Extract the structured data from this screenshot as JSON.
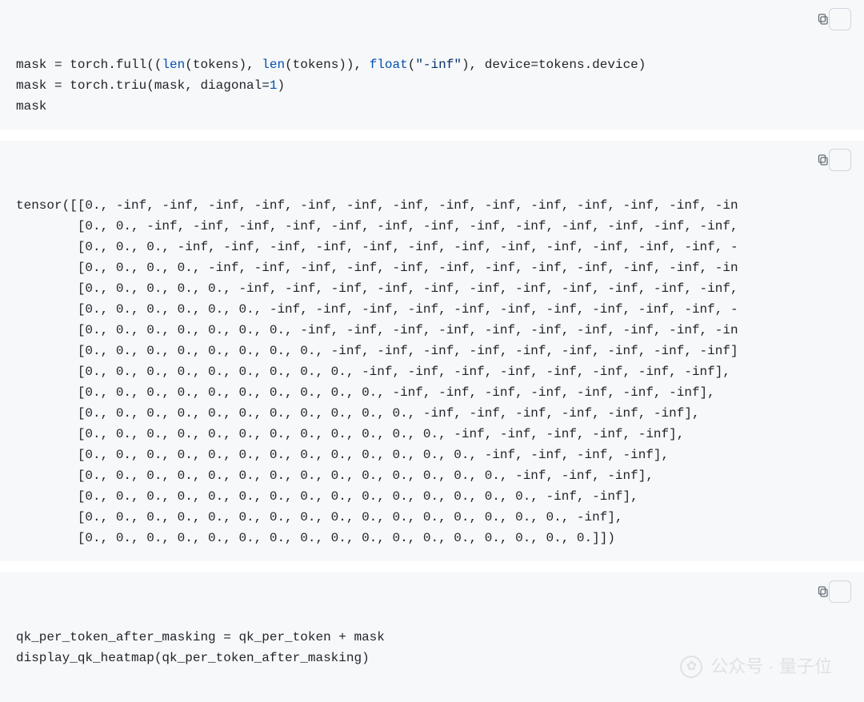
{
  "code1": {
    "line1": {
      "pre": "mask = torch.full((",
      "len1": "len",
      "mid1": "(tokens), ",
      "len2": "len",
      "mid2": "(tokens)), ",
      "float": "float",
      "mid3": "(",
      "str": "\"-inf\"",
      "mid4": "), device=tokens.device)"
    },
    "line2": {
      "pre": "mask = torch.triu(mask, diagonal=",
      "num": "1",
      "post": ")"
    },
    "line3": "mask"
  },
  "tensor_lines": [
    "tensor([[0., -inf, -inf, -inf, -inf, -inf, -inf, -inf, -inf, -inf, -inf, -inf, -inf, -inf, -in",
    "        [0., 0., -inf, -inf, -inf, -inf, -inf, -inf, -inf, -inf, -inf, -inf, -inf, -inf, -inf,",
    "        [0., 0., 0., -inf, -inf, -inf, -inf, -inf, -inf, -inf, -inf, -inf, -inf, -inf, -inf, -",
    "        [0., 0., 0., 0., -inf, -inf, -inf, -inf, -inf, -inf, -inf, -inf, -inf, -inf, -inf, -in",
    "        [0., 0., 0., 0., 0., -inf, -inf, -inf, -inf, -inf, -inf, -inf, -inf, -inf, -inf, -inf,",
    "        [0., 0., 0., 0., 0., 0., -inf, -inf, -inf, -inf, -inf, -inf, -inf, -inf, -inf, -inf, -",
    "        [0., 0., 0., 0., 0., 0., 0., -inf, -inf, -inf, -inf, -inf, -inf, -inf, -inf, -inf, -in",
    "        [0., 0., 0., 0., 0., 0., 0., 0., -inf, -inf, -inf, -inf, -inf, -inf, -inf, -inf, -inf]",
    "        [0., 0., 0., 0., 0., 0., 0., 0., 0., -inf, -inf, -inf, -inf, -inf, -inf, -inf, -inf],",
    "        [0., 0., 0., 0., 0., 0., 0., 0., 0., 0., -inf, -inf, -inf, -inf, -inf, -inf, -inf],",
    "        [0., 0., 0., 0., 0., 0., 0., 0., 0., 0., 0., -inf, -inf, -inf, -inf, -inf, -inf],",
    "        [0., 0., 0., 0., 0., 0., 0., 0., 0., 0., 0., 0., -inf, -inf, -inf, -inf, -inf],",
    "        [0., 0., 0., 0., 0., 0., 0., 0., 0., 0., 0., 0., 0., -inf, -inf, -inf, -inf],",
    "        [0., 0., 0., 0., 0., 0., 0., 0., 0., 0., 0., 0., 0., 0., -inf, -inf, -inf],",
    "        [0., 0., 0., 0., 0., 0., 0., 0., 0., 0., 0., 0., 0., 0., 0., -inf, -inf],",
    "        [0., 0., 0., 0., 0., 0., 0., 0., 0., 0., 0., 0., 0., 0., 0., 0., -inf],",
    "        [0., 0., 0., 0., 0., 0., 0., 0., 0., 0., 0., 0., 0., 0., 0., 0., 0.]])"
  ],
  "code2": {
    "line1": "qk_per_token_after_masking = qk_per_token + mask",
    "line2": "display_qk_heatmap(qk_per_token_after_masking)"
  },
  "watermark": {
    "prefix": "公众号 · ",
    "name": "量子位"
  }
}
